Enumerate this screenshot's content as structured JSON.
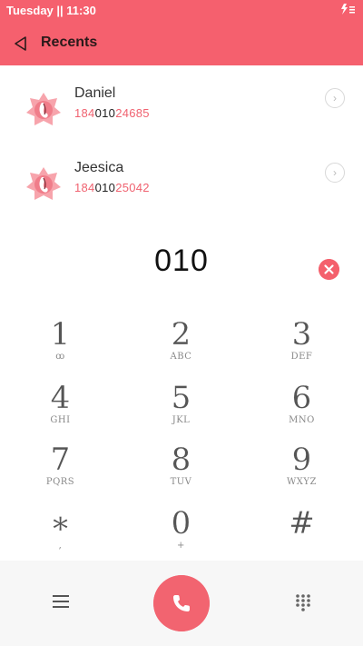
{
  "status": {
    "time": "Tuesday || 11:30",
    "icons": "⚡☰"
  },
  "appbar": {
    "title": "Recents"
  },
  "contacts": [
    {
      "name": "Daniel",
      "num_pre": "184",
      "num_match": "010",
      "num_post": "24685"
    },
    {
      "name": "Jeesica",
      "num_pre": "184",
      "num_match": "010",
      "num_post": "25042"
    }
  ],
  "dial": {
    "digits": "010"
  },
  "keys": [
    {
      "num": "1",
      "sub": "ꝏ"
    },
    {
      "num": "2",
      "sub": "ABC"
    },
    {
      "num": "3",
      "sub": "DEF"
    },
    {
      "num": "4",
      "sub": "GHI"
    },
    {
      "num": "5",
      "sub": "JKL"
    },
    {
      "num": "6",
      "sub": "MNO"
    },
    {
      "num": "7",
      "sub": "PQRS"
    },
    {
      "num": "8",
      "sub": "TUV"
    },
    {
      "num": "9",
      "sub": "WXYZ"
    },
    {
      "num": "∗",
      "sub": ","
    },
    {
      "num": "0",
      "sub": "+"
    },
    {
      "num": "#",
      "sub": ""
    }
  ],
  "colors": {
    "accent": "#f5606e",
    "match": "#222222"
  }
}
